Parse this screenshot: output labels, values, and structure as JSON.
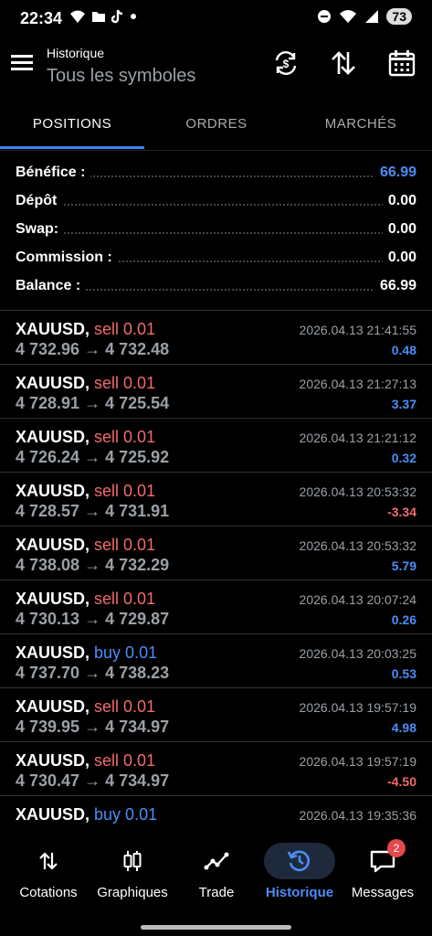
{
  "status_bar": {
    "time": "22:34",
    "battery": "73"
  },
  "header": {
    "subtitle": "Historique",
    "title": "Tous les symboles"
  },
  "tabs": [
    {
      "label": "POSITIONS"
    },
    {
      "label": "ORDRES"
    },
    {
      "label": "MARCHÉS"
    }
  ],
  "summary": [
    {
      "label": "Bénéfice :",
      "value": "66.99",
      "color": "#4c8df6"
    },
    {
      "label": "Dépôt",
      "value": "0.00",
      "color": "#ffffff"
    },
    {
      "label": "Swap:",
      "value": "0.00",
      "color": "#ffffff"
    },
    {
      "label": "Commission :",
      "value": "0.00",
      "color": "#ffffff"
    },
    {
      "label": "Balance :",
      "value": "66.99",
      "color": "#ffffff"
    }
  ],
  "deals": [
    {
      "symbol": "XAUUSD,",
      "side": "sell 0.01",
      "side_color": "#f26b6b",
      "prices": "4 732.96 → 4 732.48",
      "time": "2026.04.13 21:41:55",
      "profit": "0.48",
      "profit_color": "#4c8df6"
    },
    {
      "symbol": "XAUUSD,",
      "side": "sell 0.01",
      "side_color": "#f26b6b",
      "prices": "4 728.91 → 4 725.54",
      "time": "2026.04.13 21:27:13",
      "profit": "3.37",
      "profit_color": "#4c8df6"
    },
    {
      "symbol": "XAUUSD,",
      "side": "sell 0.01",
      "side_color": "#f26b6b",
      "prices": "4 726.24 → 4 725.92",
      "time": "2026.04.13 21:21:12",
      "profit": "0.32",
      "profit_color": "#4c8df6"
    },
    {
      "symbol": "XAUUSD,",
      "side": "sell 0.01",
      "side_color": "#f26b6b",
      "prices": "4 728.57 → 4 731.91",
      "time": "2026.04.13 20:53:32",
      "profit": "-3.34",
      "profit_color": "#f26b6b"
    },
    {
      "symbol": "XAUUSD,",
      "side": "sell 0.01",
      "side_color": "#f26b6b",
      "prices": "4 738.08 → 4 732.29",
      "time": "2026.04.13 20:53:32",
      "profit": "5.79",
      "profit_color": "#4c8df6"
    },
    {
      "symbol": "XAUUSD,",
      "side": "sell 0.01",
      "side_color": "#f26b6b",
      "prices": "4 730.13 → 4 729.87",
      "time": "2026.04.13 20:07:24",
      "profit": "0.26",
      "profit_color": "#4c8df6"
    },
    {
      "symbol": "XAUUSD,",
      "side": "buy 0.01",
      "side_color": "#4c8df6",
      "prices": "4 737.70 → 4 738.23",
      "time": "2026.04.13 20:03:25",
      "profit": "0.53",
      "profit_color": "#4c8df6"
    },
    {
      "symbol": "XAUUSD,",
      "side": "sell 0.01",
      "side_color": "#f26b6b",
      "prices": "4 739.95 → 4 734.97",
      "time": "2026.04.13 19:57:19",
      "profit": "4.98",
      "profit_color": "#4c8df6"
    },
    {
      "symbol": "XAUUSD,",
      "side": "sell 0.01",
      "side_color": "#f26b6b",
      "prices": "4 730.47 → 4 734.97",
      "time": "2026.04.13 19:57:19",
      "profit": "-4.50",
      "profit_color": "#f26b6b"
    },
    {
      "symbol": "XAUUSD,",
      "side": "buy 0.01",
      "side_color": "#4c8df6",
      "prices": "",
      "time": "2026.04.13 19:35:36",
      "profit": "",
      "profit_color": "#4c8df6"
    }
  ],
  "bottom_nav": [
    {
      "label": "Cotations",
      "icon": "updown-arrows-icon"
    },
    {
      "label": "Graphiques",
      "icon": "candles-icon"
    },
    {
      "label": "Trade",
      "icon": "trend-icon"
    },
    {
      "label": "Historique",
      "icon": "history-icon"
    },
    {
      "label": "Messages",
      "icon": "chat-icon",
      "badge": "2"
    }
  ]
}
